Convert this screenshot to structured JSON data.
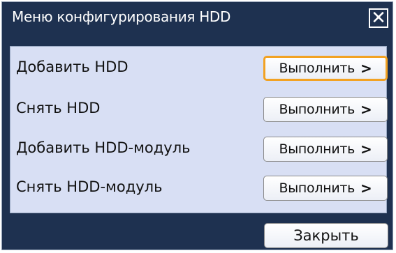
{
  "dialog": {
    "title": "Меню конфигурирования HDD",
    "close_icon": "close-icon"
  },
  "rows": [
    {
      "label": "Добавить HDD",
      "button_label": "Выполнить",
      "focused": true
    },
    {
      "label": "Снять HDD",
      "button_label": "Выполнить",
      "focused": false
    },
    {
      "label": "Добавить HDD-модуль",
      "button_label": "Выполнить",
      "focused": false
    },
    {
      "label": "Снять HDD-модуль",
      "button_label": "Выполнить",
      "focused": false
    }
  ],
  "footer": {
    "close_label": "Закрыть"
  },
  "colors": {
    "dialog_background": "#1e3150",
    "panel_background": "#d8dff4",
    "focus_outline": "#f2a223"
  }
}
